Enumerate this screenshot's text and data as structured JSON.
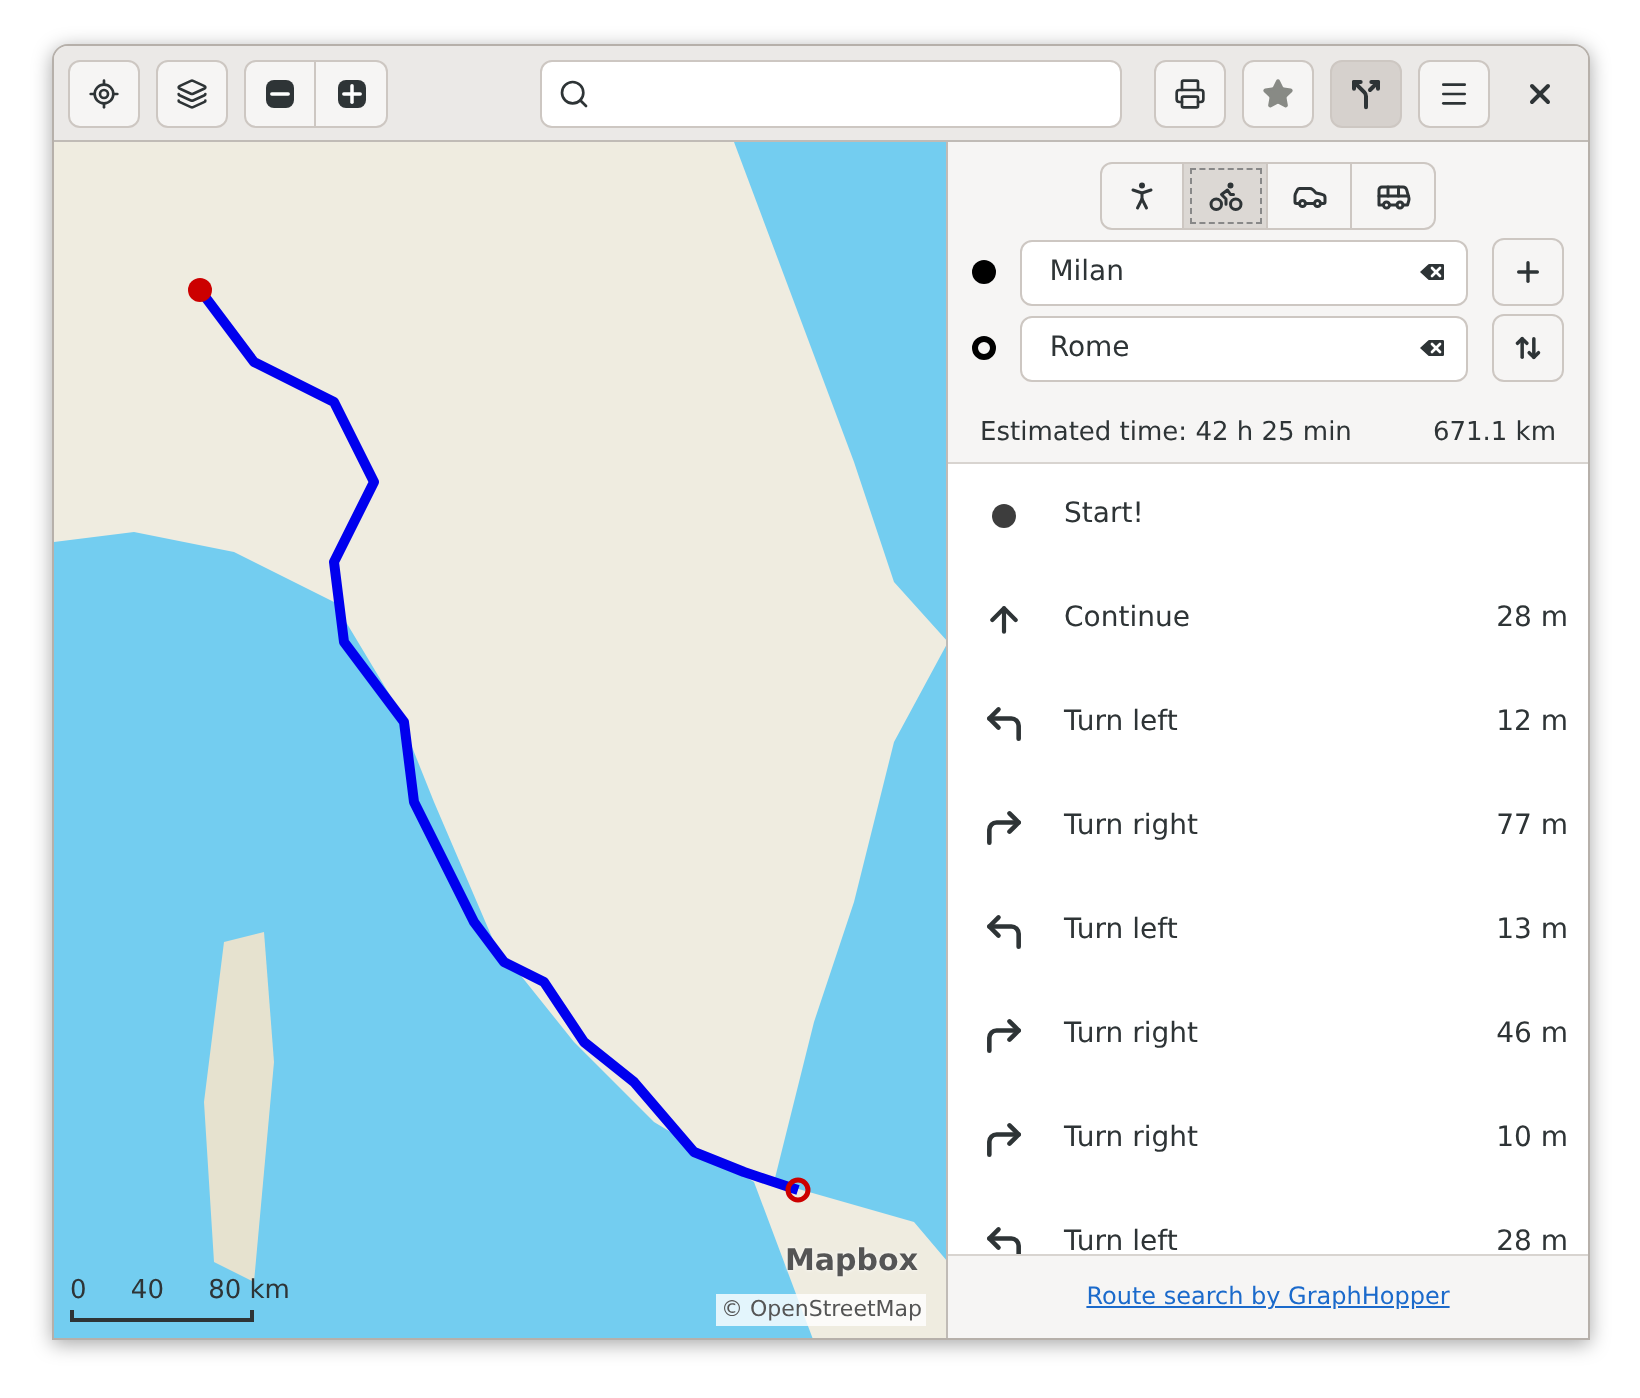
{
  "header": {
    "route_toggle": {
      "on": true
    }
  },
  "map": {
    "scale_labels": [
      "0",
      "40",
      "80 km"
    ],
    "attribution": [
      "Mapbox",
      "© OpenStreetMap"
    ]
  },
  "transport_modes": [
    {
      "kind": "walk",
      "selected": false
    },
    {
      "kind": "bike",
      "selected": true
    },
    {
      "kind": "car",
      "selected": false
    },
    {
      "kind": "transit",
      "selected": false
    }
  ],
  "route_points": [
    {
      "kind": "start",
      "value": "Milan"
    },
    {
      "kind": "end",
      "value": "Rome"
    }
  ],
  "summary": {
    "time": "Estimated time: 42 h 25 min",
    "distance": "671.1 km"
  },
  "instructions": [
    {
      "kind": "start",
      "text": "Start!"
    },
    {
      "kind": "continue",
      "text": "Continue",
      "distance": "28 m"
    },
    {
      "kind": "left",
      "text": "Turn left",
      "distance": "12 m"
    },
    {
      "kind": "right",
      "text": "Turn right",
      "distance": "77 m"
    },
    {
      "kind": "left",
      "text": "Turn left",
      "distance": "13 m"
    },
    {
      "kind": "right",
      "text": "Turn right",
      "distance": "46 m"
    },
    {
      "kind": "right",
      "text": "Turn right",
      "distance": "10 m"
    },
    {
      "kind": "left",
      "text": "Turn left",
      "distance": "28 m"
    }
  ],
  "footer_link": "Route search by GraphHopper"
}
